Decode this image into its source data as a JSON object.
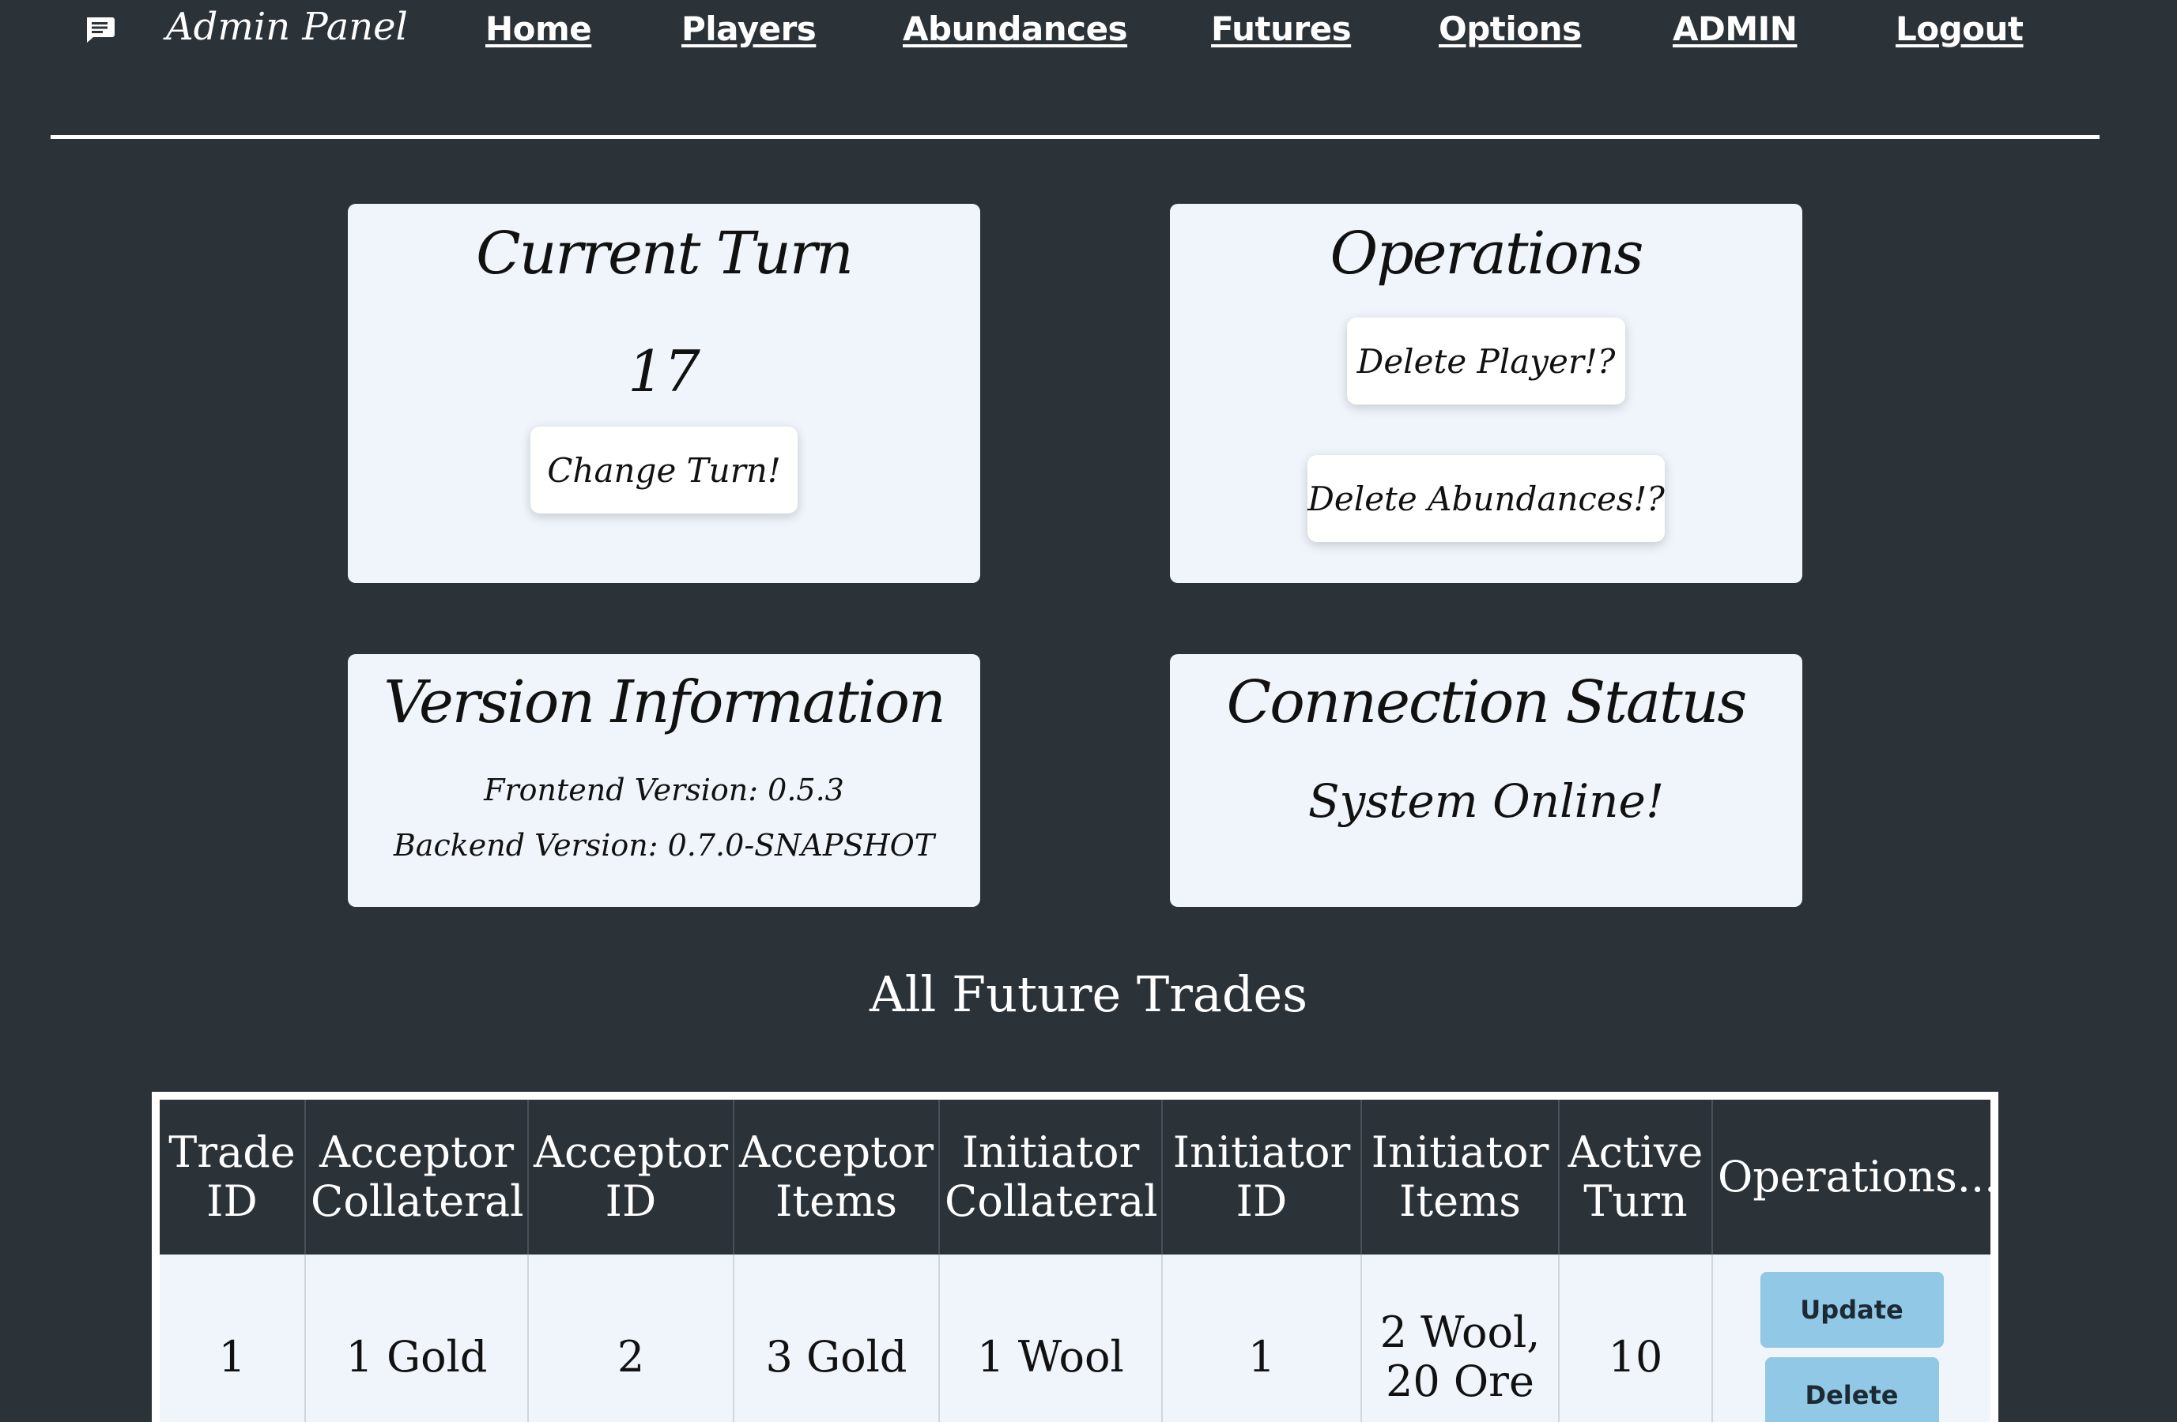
{
  "header": {
    "icon": "chat-icon",
    "brand": "Admin Panel",
    "nav": [
      {
        "label": "Home"
      },
      {
        "label": "Players"
      },
      {
        "label": "Abundances"
      },
      {
        "label": "Futures"
      },
      {
        "label": "Options"
      },
      {
        "label": "ADMIN"
      },
      {
        "label": "Logout"
      }
    ]
  },
  "current_turn": {
    "title": "Current Turn",
    "value": "17",
    "button_label": "Change Turn!"
  },
  "operations": {
    "title": "Operations",
    "delete_player_label": "Delete Player!?",
    "delete_abundances_label": "Delete Abundances!?"
  },
  "version_info": {
    "title": "Version Information",
    "frontend": "Frontend Version: 0.5.3",
    "backend": "Backend Version: 0.7.0-SNAPSHOT"
  },
  "connection": {
    "title": "Connection Status",
    "status": "System Online!"
  },
  "trades": {
    "title": "All Future Trades",
    "columns": [
      [
        "Trade",
        "ID"
      ],
      [
        "Acceptor",
        "Collateral"
      ],
      [
        "Acceptor",
        "ID"
      ],
      [
        "Acceptor",
        "Items"
      ],
      [
        "Initiator",
        "Collateral"
      ],
      [
        "Initiator",
        "ID"
      ],
      [
        "Initiator",
        "Items"
      ],
      [
        "Active",
        "Turn"
      ],
      [
        "Operations..."
      ]
    ],
    "rows": [
      {
        "trade_id": "1",
        "acceptor_collateral": "1 Gold",
        "acceptor_id": "2",
        "acceptor_items": "3 Gold",
        "initiator_collateral": "1 Wool",
        "initiator_id": "1",
        "initiator_items_line1": "2 Wool,",
        "initiator_items_line2": "20 Ore",
        "active_turn": "10",
        "update_label": "Update",
        "delete_label": "Delete"
      }
    ]
  },
  "colors": {
    "background": "#2b3238",
    "card": "#eff5fb",
    "op_button": "#90c8e6"
  }
}
